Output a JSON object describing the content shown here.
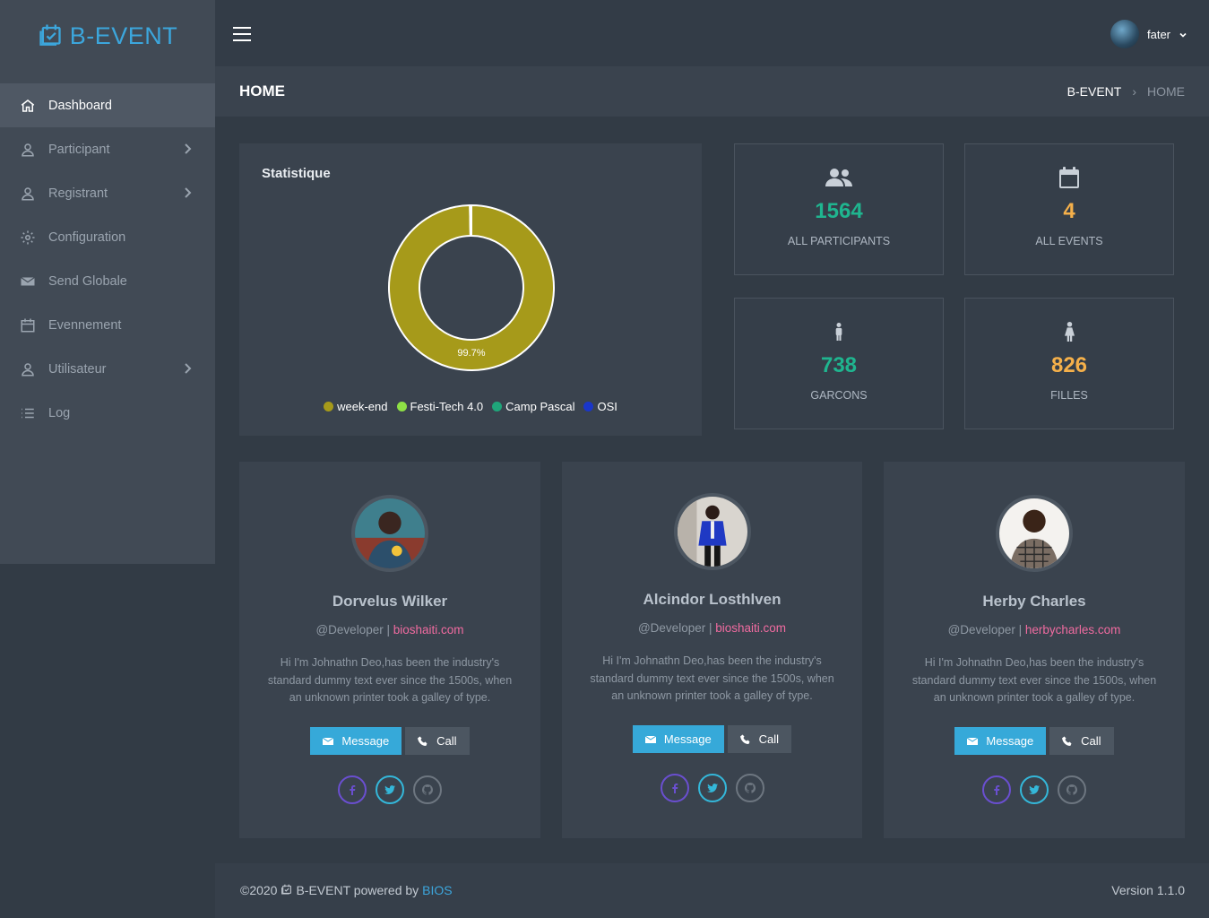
{
  "app": {
    "brand": "B-EVENT",
    "brand_color": "#3ca6dc"
  },
  "sidebar": {
    "items": [
      {
        "label": "Dashboard",
        "icon": "home-icon",
        "active": true
      },
      {
        "label": "Participant",
        "icon": "user-icon",
        "has_submenu": true
      },
      {
        "label": "Registrant",
        "icon": "user-icon",
        "has_submenu": true
      },
      {
        "label": "Configuration",
        "icon": "gear-icon"
      },
      {
        "label": "Send Globale",
        "icon": "envelope-icon"
      },
      {
        "label": "Evennement",
        "icon": "calendar-icon"
      },
      {
        "label": "Utilisateur",
        "icon": "user-icon",
        "has_submenu": true
      },
      {
        "label": "Log",
        "icon": "list-icon"
      }
    ]
  },
  "topbar": {
    "user_name": "fater"
  },
  "header": {
    "title": "HOME",
    "breadcrumb": [
      "B-EVENT",
      "HOME"
    ]
  },
  "statistique": {
    "title": "Statistique",
    "legend": [
      {
        "name": "week-end",
        "color": "#a69a1a"
      },
      {
        "name": "Festi-Tech 4.0",
        "color": "#8ee045"
      },
      {
        "name": "Camp Pascal",
        "color": "#1fa67a"
      },
      {
        "name": "OSI",
        "color": "#1a36c9"
      }
    ]
  },
  "chart_data": {
    "type": "pie",
    "title": "Statistique",
    "categories": [
      "week-end",
      "Festi-Tech 4.0",
      "Camp Pascal",
      "OSI"
    ],
    "values": [
      99.7,
      0.1,
      0.1,
      0.1
    ],
    "data_labels": [
      "99.7%"
    ],
    "legend_position": "bottom"
  },
  "stats": [
    {
      "value": "1564",
      "label": "ALL PARTICIPANTS",
      "icon": "users-icon",
      "color": "#1fb58f"
    },
    {
      "value": "4",
      "label": "ALL EVENTS",
      "icon": "calendar-icon",
      "color": "#f5b04a"
    },
    {
      "value": "738",
      "label": "GARCONS",
      "icon": "male-icon",
      "color": "#1fb58f"
    },
    {
      "value": "826",
      "label": "FILLES",
      "icon": "female-icon",
      "color": "#f5b04a"
    }
  ],
  "profiles": [
    {
      "name": "Dorvelus Wilker",
      "role": "@Developer |",
      "site": "bioshaiti.com",
      "desc": "Hi I'm Johnathn Deo,has been the industry's standard dummy text ever since the 1500s, when an unknown printer took a galley of type.",
      "message_label": "Message",
      "call_label": "Call"
    },
    {
      "name": "Alcindor Losthlven",
      "role": "@Developer |",
      "site": "bioshaiti.com",
      "desc": "Hi I'm Johnathn Deo,has been the industry's standard dummy text ever since the 1500s, when an unknown printer took a galley of type.",
      "message_label": "Message",
      "call_label": "Call"
    },
    {
      "name": "Herby Charles",
      "role": "@Developer |",
      "site": "herbycharles.com",
      "desc": "Hi I'm Johnathn Deo,has been the industry's standard dummy text ever since the 1500s, when an unknown printer took a galley of type.",
      "message_label": "Message",
      "call_label": "Call"
    }
  ],
  "footer": {
    "copy": "©2020",
    "brand": "B-EVENT powered by",
    "link": "BIOS",
    "version": "Version 1.1.0"
  }
}
